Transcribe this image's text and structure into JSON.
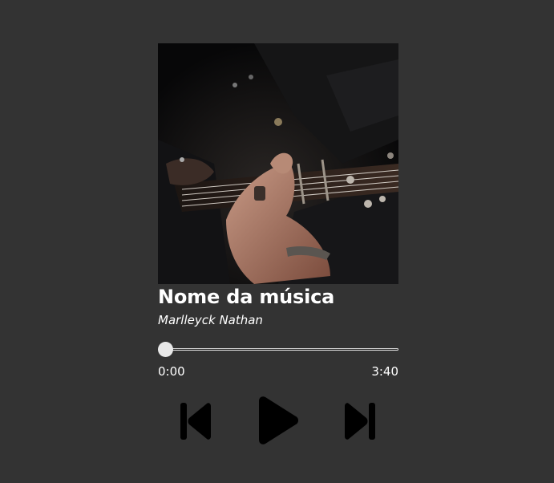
{
  "song": {
    "title": "Nome da música",
    "artist": "Marlleyck Nathan"
  },
  "progress": {
    "current_time": "0:00",
    "total_time": "3:40",
    "position_fraction": 0.0
  },
  "cover": {
    "icon": "guitarist-album-art"
  },
  "controls": {
    "previous_icon": "skip-previous-icon",
    "play_icon": "play-icon",
    "next_icon": "skip-next-icon"
  },
  "colors": {
    "background": "#333333",
    "text": "#ffffff",
    "controls": "#000000"
  }
}
